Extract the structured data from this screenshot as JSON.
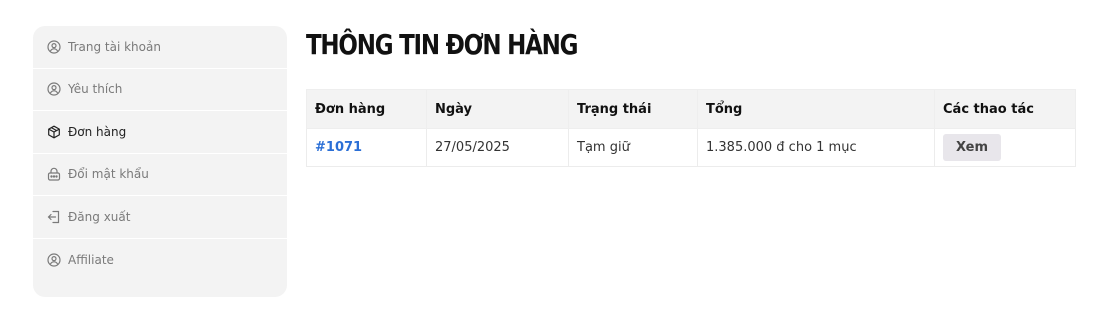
{
  "sidebar": {
    "items": [
      {
        "label": "Trang tài khoản",
        "icon": "user-circle-icon"
      },
      {
        "label": "Yêu thích",
        "icon": "user-circle-icon"
      },
      {
        "label": "Đơn hàng",
        "icon": "package-icon"
      },
      {
        "label": "Đổi mật khẩu",
        "icon": "lock-icon"
      },
      {
        "label": "Đăng xuất",
        "icon": "logout-icon"
      },
      {
        "label": "Affiliate",
        "icon": "user-circle-icon"
      }
    ],
    "active_index": 2
  },
  "page_title": "THÔNG TIN ĐƠN HÀNG",
  "table": {
    "headers": [
      "Đơn hàng",
      "Ngày",
      "Trạng thái",
      "Tổng",
      "Các thao tác"
    ],
    "rows": [
      {
        "order": "#1071",
        "date": "27/05/2025",
        "status": "Tạm giữ",
        "total": "1.385.000 đ cho 1 mục",
        "action": "Xem"
      }
    ]
  },
  "colors": {
    "link": "#2b6fd6",
    "sidebar_bg": "#f3f3f3",
    "button_bg": "#e8e6eb"
  }
}
